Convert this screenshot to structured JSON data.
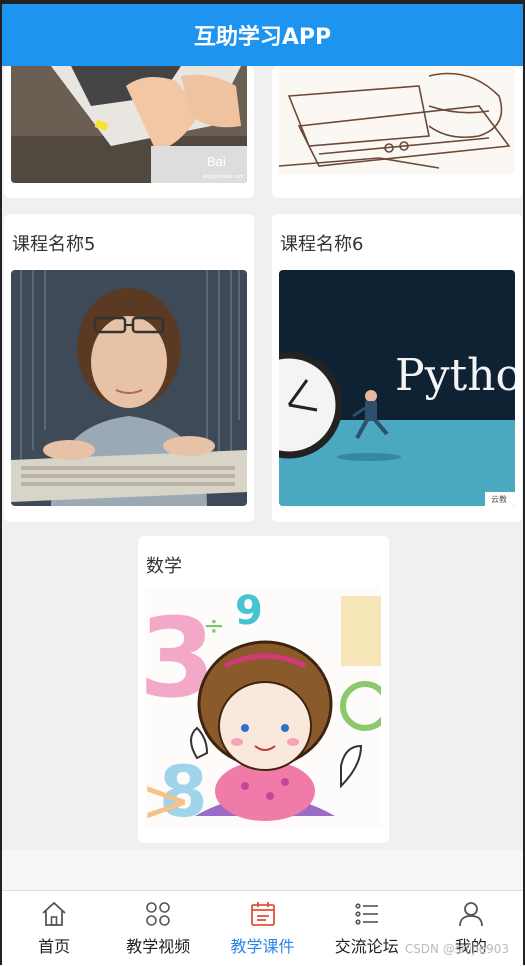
{
  "header": {
    "title": "互助学习APP"
  },
  "courses": [
    {
      "title": "课程名称5",
      "image": "boy-typing-keyboard"
    },
    {
      "title": "课程名称6",
      "image": "python-clock-runner",
      "image_text": "Pytho",
      "badge": "云教"
    },
    {
      "title": "数学",
      "image": "cartoon-girl-numbers"
    }
  ],
  "top_images": {
    "left_logo": "Bai",
    "left_logo_sub": "jingyan.baidu.com"
  },
  "tabbar": {
    "items": [
      {
        "label": "首页",
        "icon": "home-icon"
      },
      {
        "label": "教学视频",
        "icon": "grid-icon"
      },
      {
        "label": "教学课件",
        "icon": "calendar-icon"
      },
      {
        "label": "交流论坛",
        "icon": "list-icon"
      },
      {
        "label": "我的",
        "icon": "user-icon"
      }
    ],
    "active_index": 2
  },
  "watermark": "CSDN @shijie903",
  "colors": {
    "header": "#1c94f0",
    "active_tab": "#2a86e6"
  }
}
